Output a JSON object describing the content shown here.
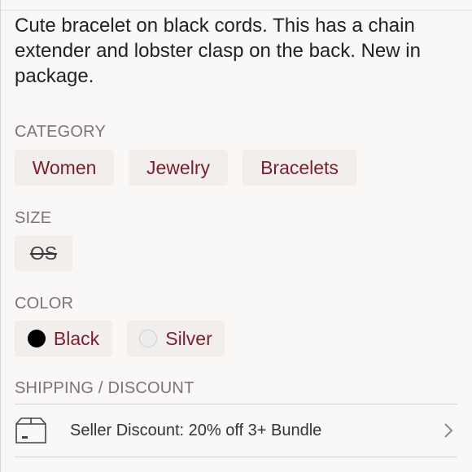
{
  "description": "Cute bracelet on black cords. This has a chain extender and lobster clasp on the back. New in package.",
  "category": {
    "label": "CATEGORY",
    "chips": [
      "Women",
      "Jewelry",
      "Bracelets"
    ]
  },
  "size": {
    "label": "SIZE",
    "value": "OS"
  },
  "color": {
    "label": "COLOR",
    "chips": [
      {
        "label": "Black",
        "swatch": "#000000"
      },
      {
        "label": "Silver",
        "swatch": "#ececec"
      }
    ]
  },
  "shipping": {
    "label": "SHIPPING / DISCOUNT",
    "discount_text": "Seller Discount: 20% off 3+ Bundle",
    "icon": "package-icon"
  }
}
